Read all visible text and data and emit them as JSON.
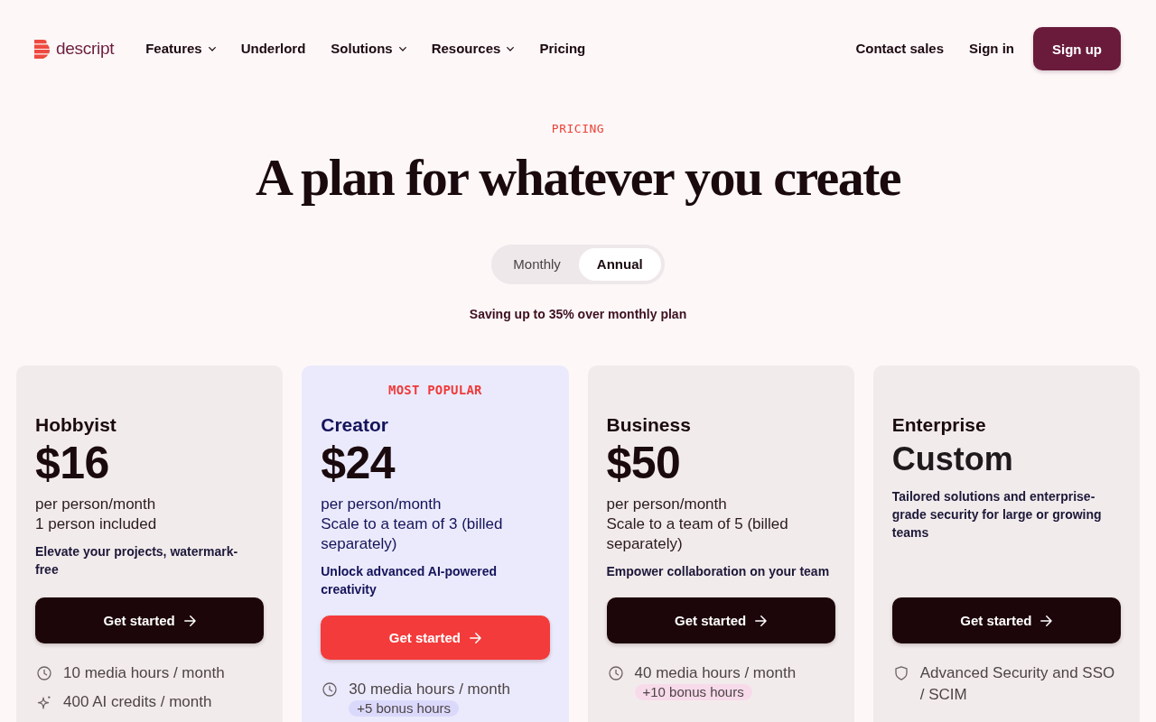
{
  "header": {
    "logo": "descript",
    "nav": [
      {
        "label": "Features",
        "has_menu": true
      },
      {
        "label": "Underlord",
        "has_menu": false
      },
      {
        "label": "Solutions",
        "has_menu": true
      },
      {
        "label": "Resources",
        "has_menu": true
      },
      {
        "label": "Pricing",
        "has_menu": false
      }
    ],
    "actions": [
      {
        "label": "Contact sales",
        "kind": "link"
      },
      {
        "label": "Sign in",
        "kind": "link"
      },
      {
        "label": "Sign up",
        "kind": "primary"
      }
    ]
  },
  "hero": {
    "eyebrow": "PRICING",
    "title": "A plan for whatever you create",
    "billing_toggle": [
      {
        "label": "Monthly",
        "selected": false
      },
      {
        "label": "Annual",
        "selected": true
      }
    ],
    "savings_note": "Saving up to 35% over monthly plan"
  },
  "plans": [
    {
      "kind": "standard",
      "name": "Hobbyist",
      "price": "$16",
      "details": [
        "per person/month",
        "1 person included"
      ],
      "tagline": "Elevate your projects, watermark-free",
      "cta": "Get started",
      "features": [
        {
          "kind": "clock",
          "text": "10 media hours / month"
        },
        {
          "kind": "sparkle",
          "text": "400 AI credits / month"
        }
      ]
    },
    {
      "kind": "featured",
      "badge": "MOST POPULAR",
      "name": "Creator",
      "price": "$24",
      "details": [
        "per person/month",
        "Scale to a team of 3 (billed separately)"
      ],
      "tagline": "Unlock advanced AI-powered creativity",
      "cta": "Get started",
      "features": [
        {
          "kind": "clock",
          "text": "30 media hours / month",
          "bonus": "+5 bonus hours"
        }
      ]
    },
    {
      "kind": "standard",
      "name": "Business",
      "price": "$50",
      "details": [
        "per person/month",
        "Scale to a team of 5 (billed separately)"
      ],
      "tagline": "Empower collaboration on your team",
      "cta": "Get started",
      "features": [
        {
          "kind": "clock",
          "text": "40 media hours / month",
          "bonus": "+10 bonus hours"
        }
      ]
    },
    {
      "kind": "custom",
      "name": "Enterprise",
      "price": "Custom",
      "tagline": "Tailored solutions and enterprise-grade security for large or growing teams",
      "cta": "Get started",
      "features": [
        {
          "kind": "shield",
          "text": "Advanced Security and SSO / SCIM"
        }
      ]
    }
  ]
}
